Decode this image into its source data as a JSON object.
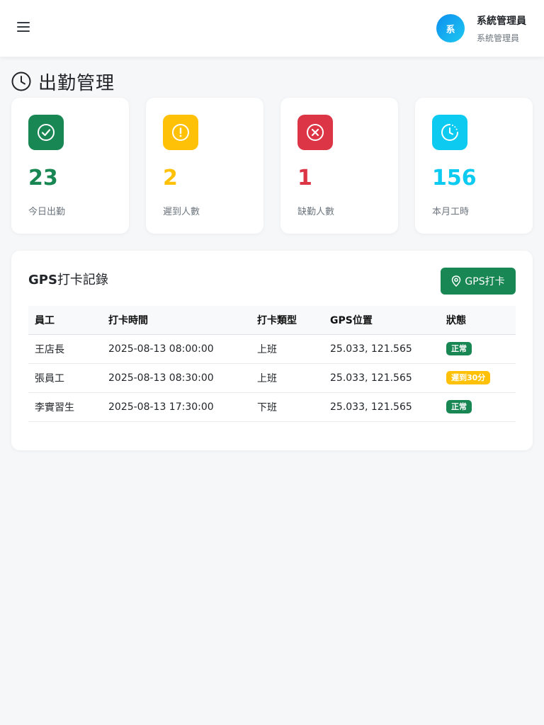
{
  "header": {
    "avatar_text": "系",
    "user_name": "系統管理員",
    "user_role": "系統管理員"
  },
  "page": {
    "title": "出勤管理"
  },
  "stats": [
    {
      "value": "23",
      "label": "今日出勤",
      "color": "#198754",
      "icon": "check-circle-icon"
    },
    {
      "value": "2",
      "label": "遲到人數",
      "color": "#ffc107",
      "icon": "exclamation-circle-icon"
    },
    {
      "value": "1",
      "label": "缺勤人數",
      "color": "#dc3545",
      "icon": "x-circle-icon"
    },
    {
      "value": "156",
      "label": "本月工時",
      "color": "#0dcaf0",
      "icon": "clock-history-icon"
    }
  ],
  "gps_records": {
    "title_prefix": "GPS",
    "title_suffix": "打卡記錄",
    "button_label": "GPS打卡",
    "columns": [
      "員工",
      "打卡時間",
      "打卡類型",
      "GPS位置",
      "狀態"
    ],
    "rows": [
      {
        "employee": "王店長",
        "time": "2025-08-13 08:00:00",
        "type": "上班",
        "location": "25.033, 121.565",
        "status": "正常",
        "status_color": "#198754"
      },
      {
        "employee": "張員工",
        "time": "2025-08-13 08:30:00",
        "type": "上班",
        "location": "25.033, 121.565",
        "status": "遲到30分",
        "status_color": "#ffc107"
      },
      {
        "employee": "李實習生",
        "time": "2025-08-13 17:30:00",
        "type": "下班",
        "location": "25.033, 121.565",
        "status": "正常",
        "status_color": "#198754"
      }
    ]
  }
}
